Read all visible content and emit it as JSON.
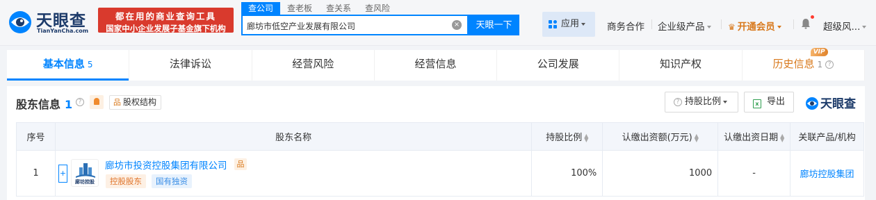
{
  "header": {
    "logo_text": "天眼查",
    "logo_subtext": "TianYanCha.com",
    "slogan_line1": "都在用的商业查询工具",
    "slogan_line2": "国家中小企业发展子基金旗下机构",
    "search_tabs": [
      "查公司",
      "查老板",
      "查关系",
      "查风险"
    ],
    "search_value": "廊坊市低空产业发展有限公司",
    "search_button": "天眼一下",
    "app_label": "应用",
    "nav": {
      "business": "商务合作",
      "enterprise": "企业级产品",
      "vip": "开通会员",
      "user": "超级风..."
    }
  },
  "tabs": [
    {
      "label": "基本信息",
      "count": "5"
    },
    {
      "label": "法律诉讼",
      "count": ""
    },
    {
      "label": "经营风险",
      "count": ""
    },
    {
      "label": "经营信息",
      "count": ""
    },
    {
      "label": "公司发展",
      "count": ""
    },
    {
      "label": "知识产权",
      "count": ""
    },
    {
      "label": "历史信息",
      "count": "1",
      "badge": "VIP"
    }
  ],
  "panel": {
    "title": "股东信息",
    "count": "1",
    "equity_button": "股权结构",
    "sort_button": "持股比例",
    "export_button": "导出",
    "watermark": "天眼查"
  },
  "table": {
    "headers": [
      "序号",
      "股东名称",
      "持股比例",
      "认缴出资额(万元)",
      "认缴出资日期",
      "关联产品/机构"
    ],
    "rows": [
      {
        "index": "1",
        "expand": "+",
        "logo_text": "廊坊控股",
        "name": "廊坊市投资控股集团有限公司",
        "tags": [
          "控股股东",
          "国有独资"
        ],
        "ratio": "100%",
        "amount": "1000",
        "date": "-",
        "related": "廊坊控股集团"
      }
    ]
  },
  "colors": {
    "brand_blue": "#0084ff",
    "slogan_red": "#d93a2d",
    "vip_orange": "#d8781b"
  }
}
